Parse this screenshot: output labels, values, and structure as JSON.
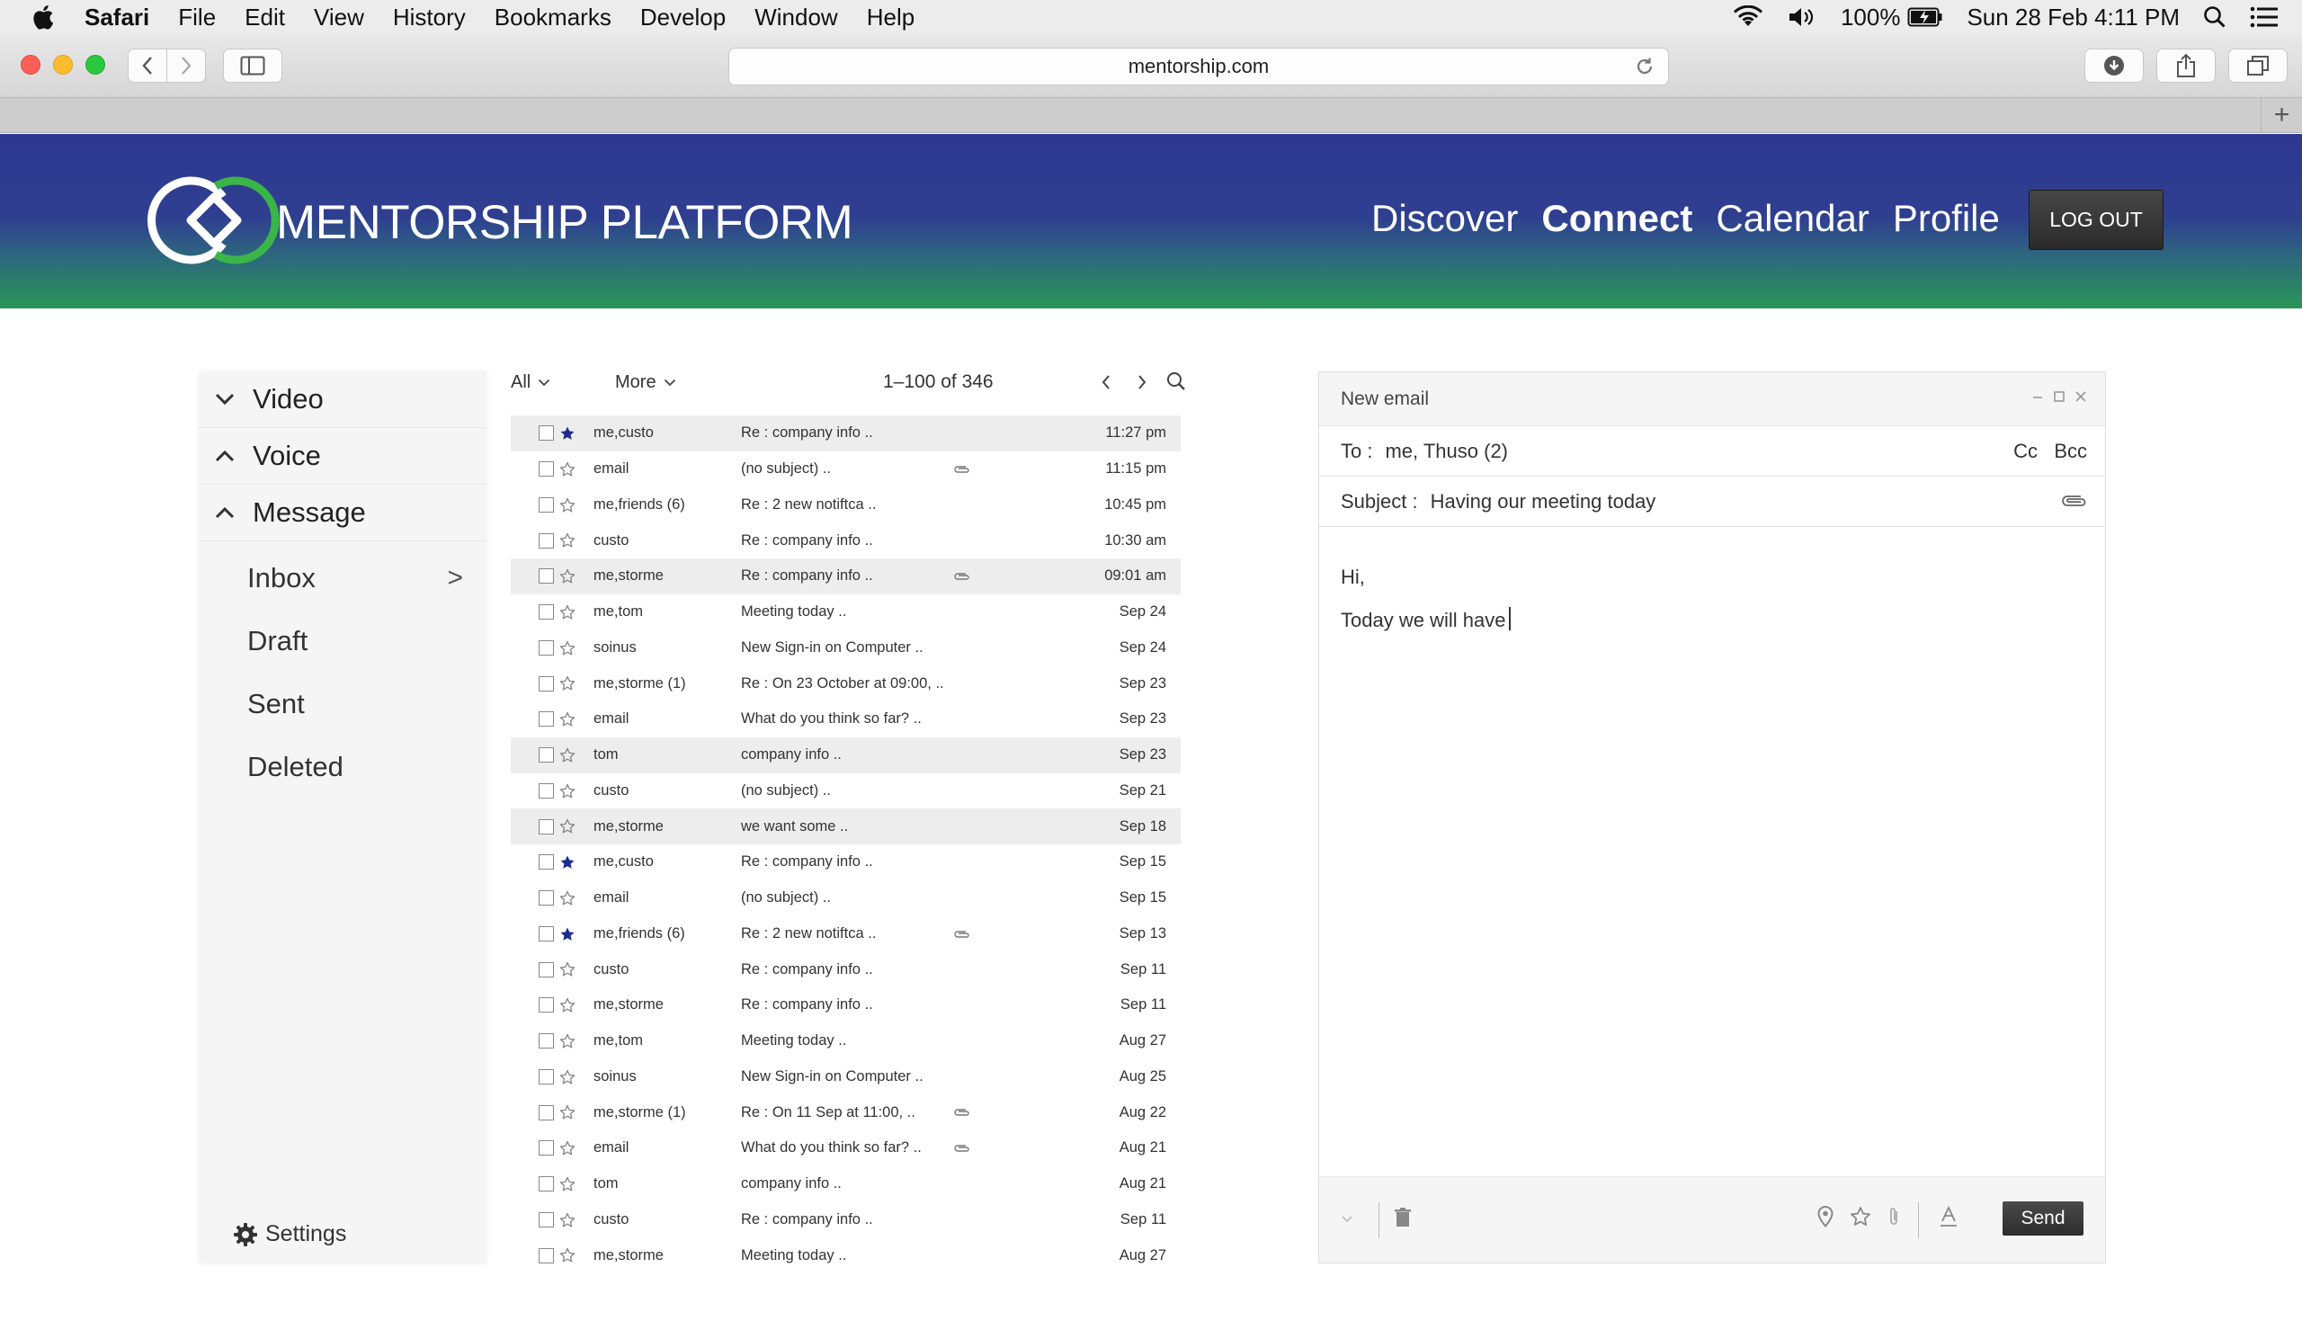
{
  "menubar": {
    "app": "Safari",
    "items": [
      "File",
      "Edit",
      "View",
      "History",
      "Bookmarks",
      "Develop",
      "Window",
      "Help"
    ],
    "battery": "100%",
    "datetime": "Sun 28 Feb  4:11 PM"
  },
  "browser": {
    "url": "mentorship.com",
    "new_tab": "+"
  },
  "site": {
    "brand": "MENTORSHIP PLATFORM",
    "nav": [
      "Discover",
      "Connect",
      "Calendar",
      "Profile"
    ],
    "active_nav": "Connect",
    "logout": "LOG OUT",
    "colors": {
      "header_top": "#2e3791",
      "header_bottom": "#2a9655",
      "logo_green": "#3bb44a"
    }
  },
  "sidebar": {
    "sections": [
      {
        "label": "Video",
        "state": "collapsed"
      },
      {
        "label": "Voice",
        "state": "expanded"
      },
      {
        "label": "Message",
        "state": "expanded"
      }
    ],
    "message_items": [
      {
        "label": "Inbox",
        "arrow": ">"
      },
      {
        "label": "Draft"
      },
      {
        "label": "Sent"
      },
      {
        "label": "Deleted"
      }
    ],
    "settings": "Settings"
  },
  "list": {
    "filter": "All",
    "more": "More",
    "range": "1–100 of 346",
    "rows": [
      {
        "from": "me,custo",
        "subject": "Re : company info ..",
        "date": "11:27 pm",
        "starred": true,
        "attachment": false,
        "shaded": true
      },
      {
        "from": "email",
        "subject": "(no subject) ..",
        "date": "11:15 pm",
        "starred": false,
        "attachment": true,
        "shaded": false
      },
      {
        "from": "me,friends (6)",
        "subject": "Re : 2 new notiftca ..",
        "date": "10:45 pm",
        "starred": false,
        "attachment": false,
        "shaded": false
      },
      {
        "from": "custo",
        "subject": "Re : company info ..",
        "date": "10:30 am",
        "starred": false,
        "attachment": false,
        "shaded": false
      },
      {
        "from": "me,storme",
        "subject": "Re : company info ..",
        "date": "09:01 am",
        "starred": false,
        "attachment": true,
        "shaded": true
      },
      {
        "from": "me,tom",
        "subject": "Meeting today ..",
        "date": "Sep 24",
        "starred": false,
        "attachment": false,
        "shaded": false
      },
      {
        "from": "soinus",
        "subject": "New Sign-in on Computer ..",
        "date": "Sep 24",
        "starred": false,
        "attachment": false,
        "shaded": false
      },
      {
        "from": "me,storme (1)",
        "subject": "Re : On 23 October at 09:00, ..",
        "date": "Sep 23",
        "starred": false,
        "attachment": false,
        "shaded": false
      },
      {
        "from": "email",
        "subject": "What do you think so far? ..",
        "date": "Sep 23",
        "starred": false,
        "attachment": false,
        "shaded": false
      },
      {
        "from": "tom",
        "subject": "company info ..",
        "date": "Sep 23",
        "starred": false,
        "attachment": false,
        "shaded": true
      },
      {
        "from": "custo",
        "subject": "(no subject) ..",
        "date": "Sep 21",
        "starred": false,
        "attachment": false,
        "shaded": false
      },
      {
        "from": "me,storme",
        "subject": "we want some ..",
        "date": "Sep 18",
        "starred": false,
        "attachment": false,
        "shaded": true
      },
      {
        "from": "me,custo",
        "subject": "Re : company info ..",
        "date": "Sep 15",
        "starred": true,
        "attachment": false,
        "shaded": false
      },
      {
        "from": "email",
        "subject": "(no subject) ..",
        "date": "Sep 15",
        "starred": false,
        "attachment": false,
        "shaded": false
      },
      {
        "from": "me,friends (6)",
        "subject": "Re : 2 new notiftca ..",
        "date": "Sep 13",
        "starred": true,
        "attachment": true,
        "shaded": false
      },
      {
        "from": "custo",
        "subject": "Re : company info ..",
        "date": "Sep 11",
        "starred": false,
        "attachment": false,
        "shaded": false
      },
      {
        "from": "me,storme",
        "subject": "Re : company info ..",
        "date": "Sep 11",
        "starred": false,
        "attachment": false,
        "shaded": false
      },
      {
        "from": "me,tom",
        "subject": "Meeting today ..",
        "date": "Aug 27",
        "starred": false,
        "attachment": false,
        "shaded": false
      },
      {
        "from": "soinus",
        "subject": "New Sign-in on Computer ..",
        "date": "Aug 25",
        "starred": false,
        "attachment": false,
        "shaded": false
      },
      {
        "from": "me,storme (1)",
        "subject": "Re : On 11 Sep at 11:00, ..",
        "date": "Aug 22",
        "starred": false,
        "attachment": true,
        "shaded": false
      },
      {
        "from": "email",
        "subject": "What do you think so far? ..",
        "date": "Aug 21",
        "starred": false,
        "attachment": true,
        "shaded": false
      },
      {
        "from": "tom",
        "subject": "company info ..",
        "date": "Aug 21",
        "starred": false,
        "attachment": false,
        "shaded": false
      },
      {
        "from": "custo",
        "subject": "Re : company info ..",
        "date": "Sep 11",
        "starred": false,
        "attachment": false,
        "shaded": false
      },
      {
        "from": "me,storme",
        "subject": "Meeting today ..",
        "date": "Aug 27",
        "starred": false,
        "attachment": false,
        "shaded": false
      }
    ]
  },
  "compose": {
    "title": "New email",
    "to_label": "To :",
    "to_value": "me, Thuso (2)",
    "cc": "Cc",
    "bcc": "Bcc",
    "subject_label": "Subject :",
    "subject_value": "Having our meeting today",
    "body_greeting": "Hi,",
    "body_text": "Today we will have",
    "send": "Send"
  }
}
